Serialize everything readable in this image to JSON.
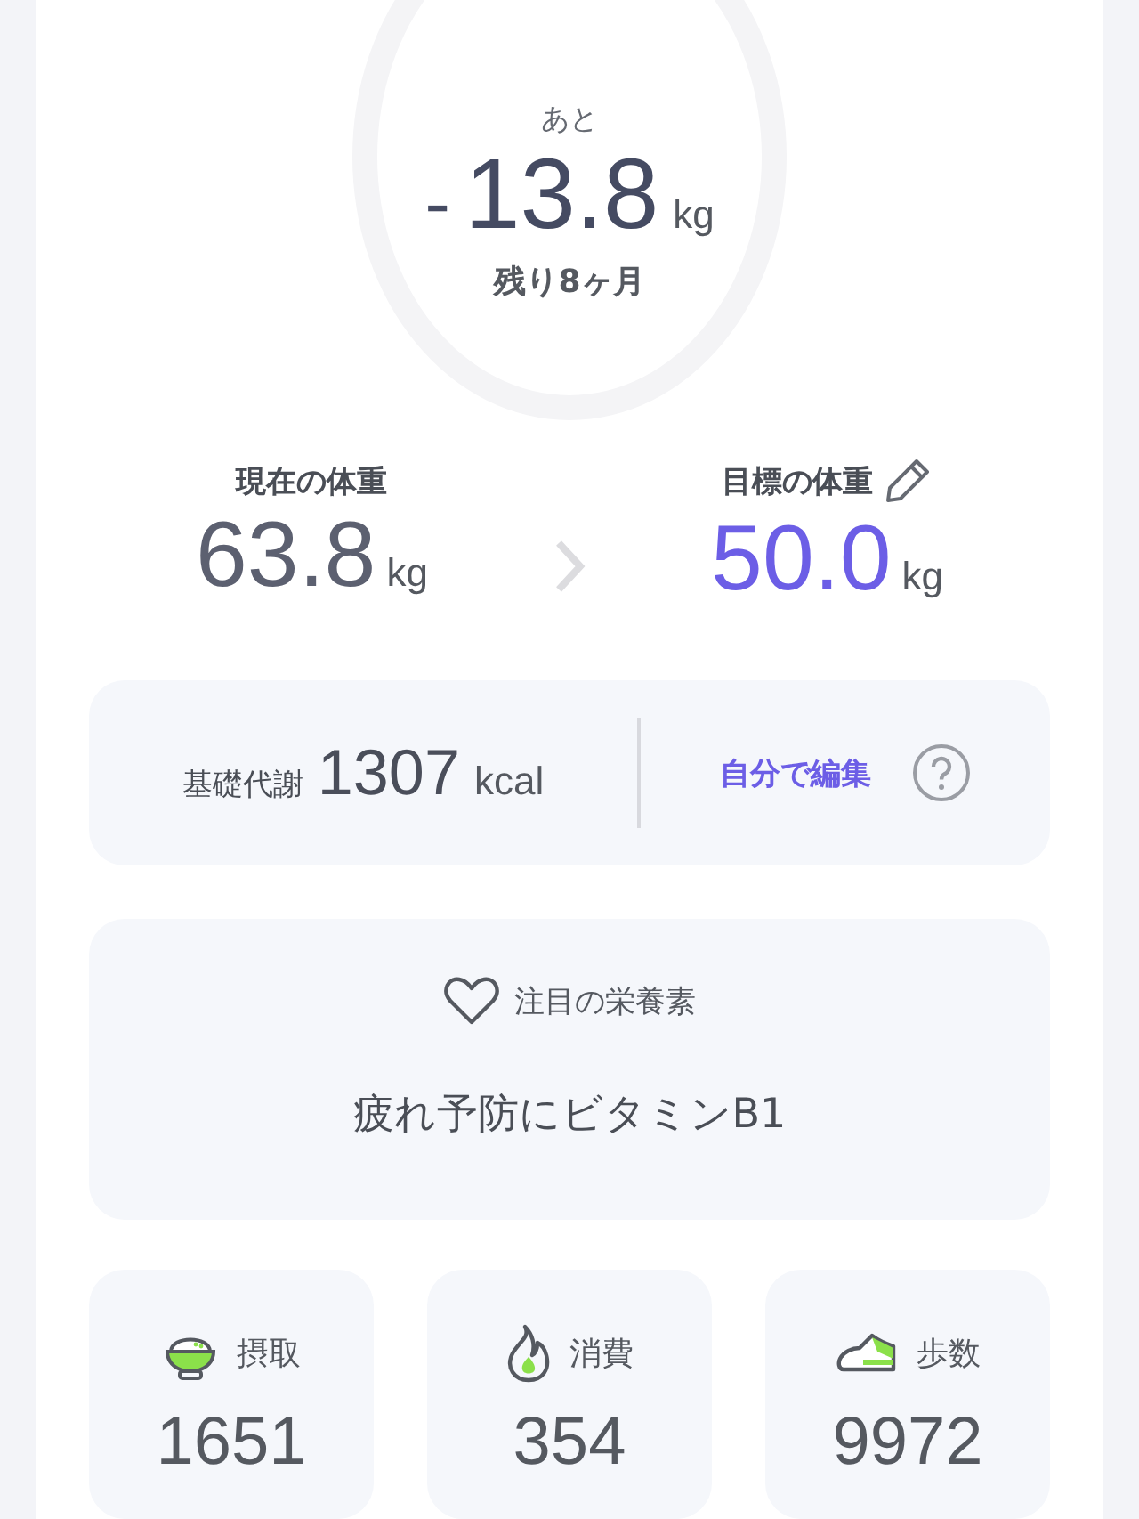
{
  "remaining": {
    "label": "あと",
    "sign": "-",
    "value": "13.8",
    "unit": "kg",
    "period": "残り8ヶ月"
  },
  "current": {
    "label": "現在の体重",
    "value": "63.8",
    "unit": "kg"
  },
  "target": {
    "label": "目標の体重",
    "value": "50.0",
    "unit": "kg"
  },
  "metabolism": {
    "label": "基礎代謝",
    "value": "1307",
    "unit": "kcal",
    "edit_link": "自分で編集"
  },
  "nutrient": {
    "label": "注目の栄養素",
    "text": "疲れ予防にビタミンB1"
  },
  "stats": [
    {
      "kind": "intake",
      "label": "摂取",
      "value": "1651"
    },
    {
      "kind": "burned",
      "label": "消費",
      "value": "354"
    },
    {
      "kind": "steps",
      "label": "歩数",
      "value": "9972"
    }
  ]
}
